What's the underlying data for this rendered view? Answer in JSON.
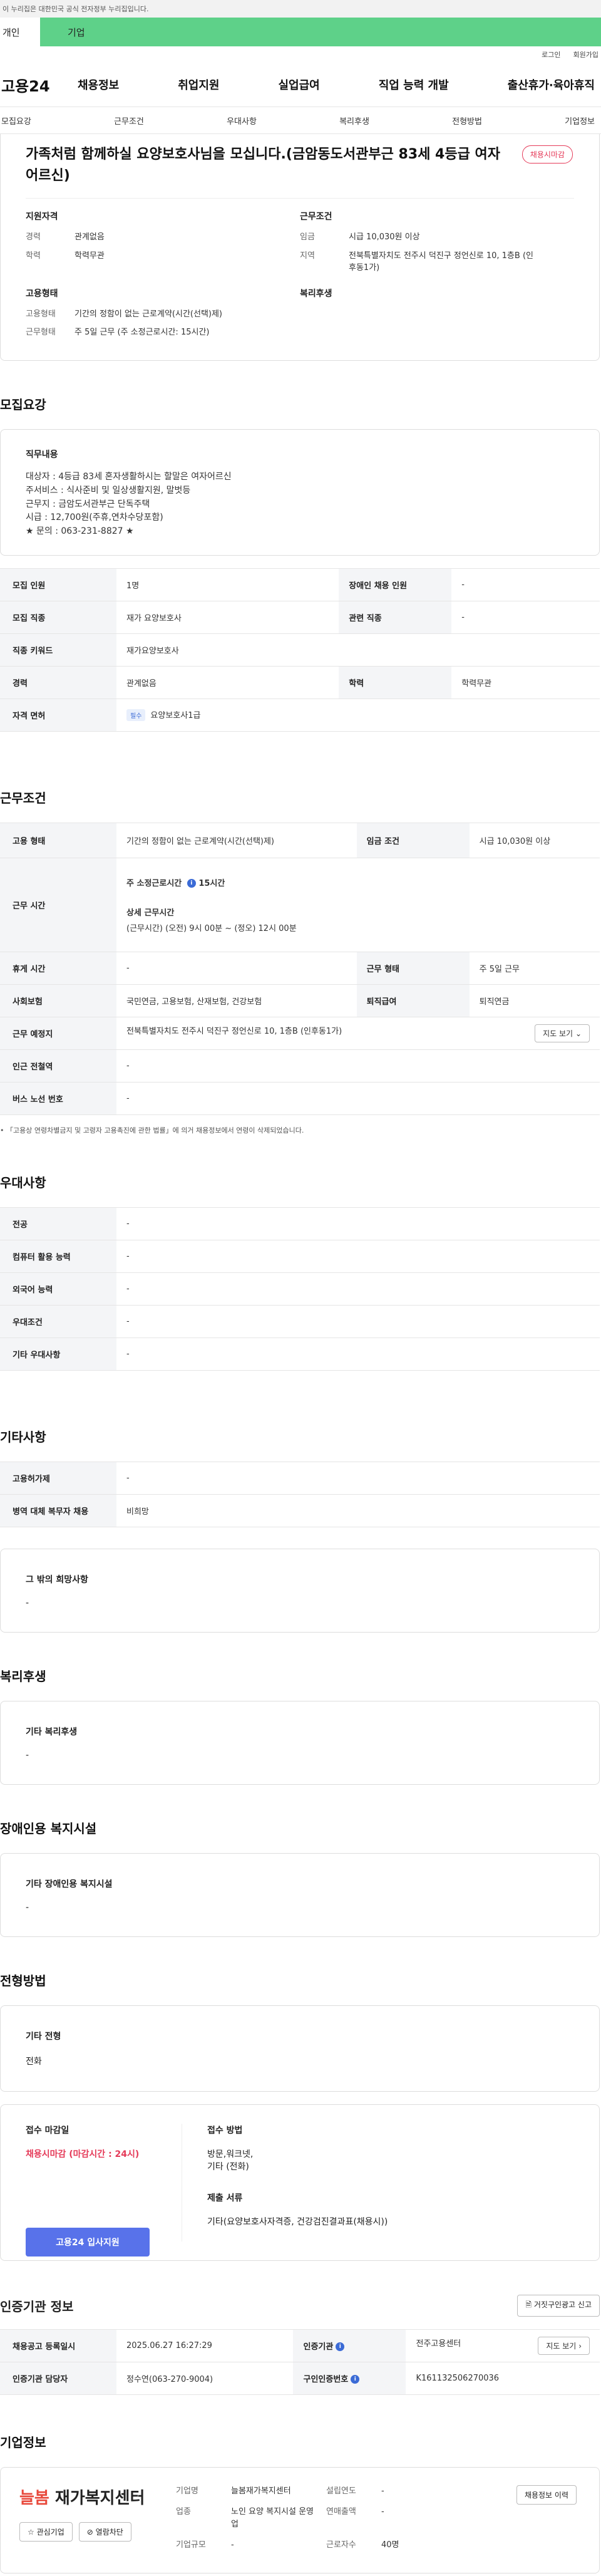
{
  "gov_banner": "이 누리집은 대한민국 공식 전자정부 누리집입니다.",
  "user_tabs": [
    "개인",
    "기업"
  ],
  "util": [
    "로그인",
    "회원가입"
  ],
  "logo": "고용24",
  "gnb": [
    "채용정보",
    "취업지원",
    "실업급여",
    "직업 능력 개발",
    "출산휴가·육아휴직"
  ],
  "subnav": [
    "모집요강",
    "근무조건",
    "우대사항",
    "복리후생",
    "전형방법",
    "기업정보"
  ],
  "header": {
    "title": "가족처럼 함께하실 요양보호사님을 모십니다.(금암동도서관부근 83세 4등급 여자어르신)",
    "status_badge": "채용시마감",
    "qualification_title": "지원자격",
    "qualification": [
      {
        "k": "경력",
        "v": "관계없음"
      },
      {
        "k": "학력",
        "v": "학력무관"
      }
    ],
    "work_title": "근무조건",
    "work": [
      {
        "k": "임금",
        "v": "시급 10,030원 이상"
      },
      {
        "k": "지역",
        "v": "전북특별자치도 전주시 덕진구 정언신로 10, 1층B (인후동1가)"
      }
    ],
    "employment_title": "고용형태",
    "employment": [
      {
        "k": "고용형태",
        "v": "기간의 정함이 없는 근로계약(시간(선택)제)"
      },
      {
        "k": "근무형태",
        "v": "주 5일 근무 (주 소정근로시간: 15시간)"
      }
    ],
    "welfare_title": "복리후생"
  },
  "recruit": {
    "section_title": "모집요강",
    "desc_title": "직무내용",
    "desc_lines": [
      "대상자 : 4등급 83세 혼자생활하시는 할말은 여자어르신",
      "주서비스 : 식사준비 및 일상생활지원, 말벗등",
      "근무지 : 금암도서관부근 단독주택",
      "시급 : 12,700원(주휴,연차수당포함)",
      "★ 문의 : 063-231-8827 ★"
    ],
    "rows": [
      {
        "k1": "모집 인원",
        "v1": "1명",
        "k2": "장애인 채용 인원",
        "v2": "-"
      },
      {
        "k1": "모집 직종",
        "v1": "재가 요양보호사",
        "k2": "관련 직종",
        "v2": "-"
      },
      {
        "k1": "직종 키워드",
        "v1": "재가요양보호사"
      },
      {
        "k1": "경력",
        "v1": "관계없음",
        "k2": "학력",
        "v2": "학력무관"
      }
    ],
    "license_label": "자격 면허",
    "license_pill": "필수",
    "license_value": "요양보호사1급"
  },
  "conditions": {
    "section_title": "근무조건",
    "employment_type_label": "고용 형태",
    "employment_type": "기간의 정함이 없는 근로계약(시간(선택)제)",
    "wage_label": "임금 조건",
    "wage": "시급 10,030원 이상",
    "worktime_label": "근무 시간",
    "weekly_hours_label": "주 소정근로시간",
    "weekly_hours": "15시간",
    "detail_hours_label": "상세 근무시간",
    "detail_hours": "(근무시간) (오전) 9시 00분 ~ (정오) 12시 00분",
    "rest_label": "휴게 시간",
    "rest": "-",
    "shift_label": "근무 형태",
    "shift": "주 5일 근무",
    "insurance_label": "사회보험",
    "insurance": "국민연금, 고용보험, 산재보험, 건강보험",
    "severance_label": "퇴직급여",
    "severance": "퇴직연금",
    "place_label": "근무 예정지",
    "place": "전북특별자치도 전주시 덕진구 정언신로 10, 1층B (인후동1가)",
    "map_button": "지도 보기",
    "subway_label": "인근 전철역",
    "subway": "-",
    "bus_label": "버스 노선 번호",
    "bus": "-",
    "note": "「고용상 연령차별금지 및 고령자 고용촉진에 관한 법률」에 의거 채용정보에서 연령이 삭제되었습니다."
  },
  "preference": {
    "section_title": "우대사항",
    "rows": [
      {
        "k": "전공",
        "v": "-"
      },
      {
        "k": "컴퓨터 활용 능력",
        "v": "-"
      },
      {
        "k": "외국어 능력",
        "v": "-"
      },
      {
        "k": "우대조건",
        "v": "-"
      },
      {
        "k": "기타 우대사항",
        "v": "-"
      }
    ]
  },
  "etc": {
    "section_title": "기타사항",
    "rows": [
      {
        "k": "고용허가제",
        "v": "-"
      },
      {
        "k": "병역 대체 복무자 채용",
        "v": "비희망"
      }
    ],
    "other_title": "그 밖의 희망사항",
    "other_value": "-"
  },
  "welfare": {
    "section_title": "복리후생",
    "title": "기타 복리후생",
    "value": "-"
  },
  "disability": {
    "section_title": "장애인용 복지시설",
    "title": "기타 장애인용 복지시설",
    "value": "-"
  },
  "screening": {
    "section_title": "전형방법",
    "title": "기타 전형",
    "value": "전화",
    "deadline_title": "접수 마감일",
    "deadline": "채용시마감 (마감시간 : 24시)",
    "apply_button": "고용24 입사지원",
    "method_title": "접수 방법",
    "method_lines": [
      "방문,워크넷,",
      "기타 (전화)"
    ],
    "docs_title": "제출 서류",
    "docs": "기타(요양보호사자격증, 건강검진결과표(채용시))"
  },
  "cert": {
    "section_title": "인증기관 정보",
    "false_report_button": "거짓구인광고 신고",
    "reg_label": "채용공고 등록일시",
    "reg": "2025.06.27 16:27:29",
    "agency_label": "인증기관",
    "agency": "전주고용센터",
    "map_button": "지도 보기",
    "manager_label": "인증기관 담당자",
    "manager": "정수연(063-270-9004)",
    "cert_no_label": "구인인증번호",
    "cert_no": "K161132506270036"
  },
  "company": {
    "section_title": "기업정보",
    "logo_brand": "늘봄",
    "logo_name": "재가복지센터",
    "fav_button": "관심기업",
    "block_button": "열람차단",
    "history_button": "채용정보 이력",
    "info": [
      {
        "k": "기업명",
        "v": "늘봄재가복지센터"
      },
      {
        "k": "설립연도",
        "v": "-"
      },
      {
        "k": "업종",
        "v": "노인 요양 복지시설 운영업"
      },
      {
        "k": "연매출액",
        "v": "-"
      },
      {
        "k": "기업규모",
        "v": "-"
      },
      {
        "k": "근로자수",
        "v": "40명"
      }
    ]
  },
  "colors": {
    "primary": "#5872ea",
    "accent_green": "#5ed189",
    "alert": "#e53b59"
  }
}
